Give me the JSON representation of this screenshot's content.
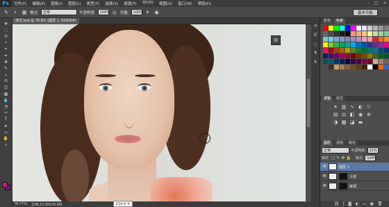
{
  "app": {
    "logo": "Ps"
  },
  "menubar": {
    "items": [
      "文件(F)",
      "编辑(E)",
      "图像(I)",
      "图层(L)",
      "类型(Y)",
      "选择(S)",
      "滤镜(T)",
      "3D(D)",
      "视图(V)",
      "窗口(W)",
      "帮助(H)"
    ]
  },
  "options": {
    "mode_label": "模式:",
    "mode_value": "正常",
    "opacity_label": "不透明度:",
    "opacity_value": "100%",
    "flow_label": "流量:",
    "flow_value": "100%",
    "workspace": "基本功能"
  },
  "document": {
    "tab_title": "演文.psd @ 76.8% (图层 1, RGB/8#)"
  },
  "status": {
    "zoom": "76.77%",
    "doc_info": "文档:10.5M/26.8M"
  },
  "hint": {
    "text": "Ctrl ⟳ ⚲"
  },
  "panels": {
    "swatch_tabs": [
      "颜色",
      "色板"
    ],
    "adjust_tabs": [
      "调整",
      "样式"
    ],
    "layer_tabs": [
      "图层",
      "通道",
      "路径"
    ],
    "blend_mode": "正常",
    "opacity_label": "不透明度:",
    "opacity_value": "21%",
    "lock_label": "锁定:",
    "fill_label": "填充:",
    "fill_value": "100%",
    "layers": [
      {
        "name": "图层 1",
        "selected": true
      },
      {
        "name": "冷调",
        "selected": false
      },
      {
        "name": "暖调",
        "selected": false
      }
    ]
  },
  "swatch_colors": [
    "#ff0000",
    "#ffff00",
    "#00ff00",
    "#00ffff",
    "#0000ff",
    "#ff00ff",
    "#ffffff",
    "#e6e6e6",
    "#cccccc",
    "#b3b3b3",
    "#999999",
    "#808080",
    "#666666",
    "#4d4d4d",
    "#333333",
    "#1a1a1a",
    "#000000",
    "#f7977a",
    "#f9ad81",
    "#fdc68a",
    "#fff79a",
    "#c4df9b",
    "#a3d39c",
    "#82ca9d",
    "#7bcdc8",
    "#6ecff6",
    "#7ea7d8",
    "#8493ca",
    "#8882be",
    "#a187be",
    "#bc8dbf",
    "#f49ac2",
    "#f6989d",
    "#ed1c24",
    "#f26522",
    "#f7941d",
    "#fff200",
    "#8dc63f",
    "#39b54a",
    "#00a651",
    "#00a99d",
    "#00aeef",
    "#0072bc",
    "#0054a6",
    "#2e3192",
    "#662d91",
    "#92278f",
    "#ec008c",
    "#ed145b",
    "#9e0b0f",
    "#a0410d",
    "#a36209",
    "#aba000",
    "#598527",
    "#1a7b30",
    "#007236",
    "#00746b",
    "#0076a3",
    "#004b80",
    "#003471",
    "#1b1464",
    "#440e62",
    "#630460",
    "#9e005d",
    "#9e0039",
    "#790000",
    "#7b2e00",
    "#7d4900",
    "#827b00",
    "#406618",
    "#005e20",
    "#005826",
    "#005952",
    "#005b7f",
    "#003663",
    "#002157",
    "#0d004c",
    "#32004b",
    "#4b0049",
    "#7b0046",
    "#7a0026",
    "#c7b299",
    "#998675",
    "#736357",
    "#534741",
    "#37302a",
    "#c69c6d",
    "#a67c52",
    "#8c6239",
    "#754c24",
    "#603913",
    "#42210b",
    "#ffffff",
    "#000000",
    "#ff6600",
    "#3366cc"
  ],
  "toolbar": {
    "tools": [
      "move",
      "marquee",
      "lasso",
      "quick-select",
      "crop",
      "eyedropper",
      "heal",
      "brush",
      "stamp",
      "history",
      "eraser",
      "gradient",
      "blur",
      "dodge",
      "pen",
      "type",
      "path-select",
      "shape",
      "hand",
      "zoom"
    ]
  }
}
